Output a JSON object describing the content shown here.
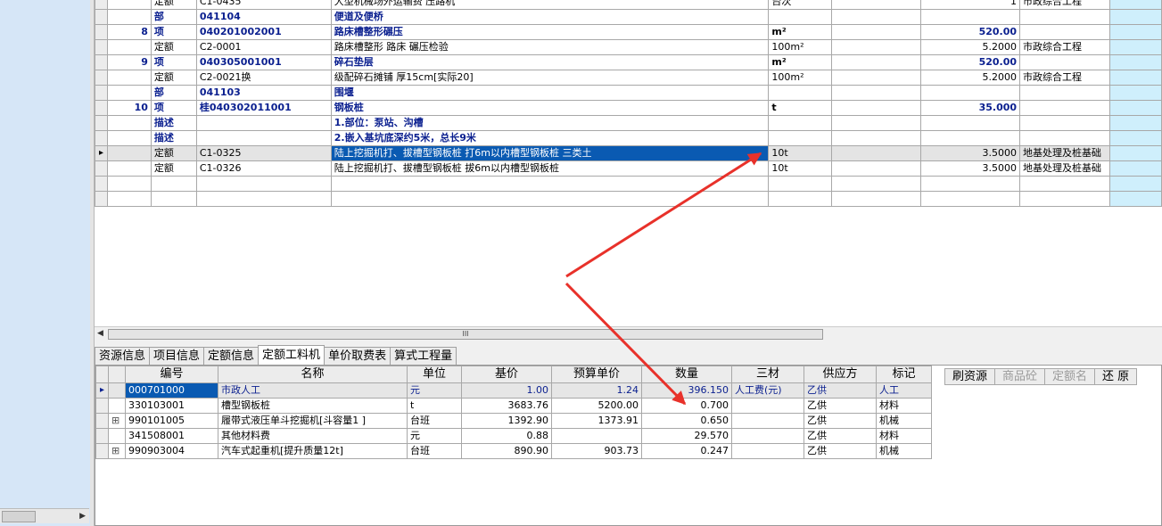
{
  "top_grid": {
    "rows": [
      {
        "type": "定额",
        "code": "C1-0435",
        "name": "大型机械场外运输费 压路机",
        "unit": "台次",
        "qty": "1",
        "cat": "市政综合工程",
        "style": "normal"
      },
      {
        "type": "部",
        "code": "041104",
        "name": "便道及便桥",
        "unit": "",
        "qty": "",
        "cat": "",
        "style": "bold"
      },
      {
        "no": "8",
        "type": "项",
        "code": "040201002001",
        "name": "路床槽整形碾压",
        "unit": "m²",
        "qty": "520.00",
        "cat": "",
        "style": "bold"
      },
      {
        "type": "定额",
        "code": "C2-0001",
        "name": "路床槽整形 路床 碾压检验",
        "unit": "100m²",
        "qty": "5.2000",
        "cat": "市政综合工程",
        "style": "normal"
      },
      {
        "no": "9",
        "type": "项",
        "code": "040305001001",
        "name": "碎石垫层",
        "unit": "m²",
        "qty": "520.00",
        "cat": "",
        "style": "bold"
      },
      {
        "type": "定额",
        "code": "C2-0021换",
        "name": "级配碎石摊铺 厚15cm[实际20]",
        "unit": "100m²",
        "qty": "5.2000",
        "cat": "市政综合工程",
        "style": "normal"
      },
      {
        "type": "部",
        "code": "041103",
        "name": "围堰",
        "unit": "",
        "qty": "",
        "cat": "",
        "style": "bold"
      },
      {
        "no": "10",
        "type": "项",
        "code": "桂040302011001",
        "name": "钢板桩",
        "unit": "t",
        "qty": "35.000",
        "cat": "",
        "style": "bold"
      },
      {
        "type": "描述",
        "code": "",
        "name": "1.部位：泵站、沟槽",
        "unit": "",
        "qty": "",
        "cat": "",
        "style": "bold"
      },
      {
        "type": "描述",
        "code": "",
        "name": "2.嵌入基坑底深约5米，总长9米",
        "unit": "",
        "qty": "",
        "cat": "",
        "style": "bold"
      },
      {
        "type": "定额",
        "code": "C1-0325",
        "name": "陆上挖掘机打、拔槽型钢板桩 打6m以内槽型钢板桩 三类土",
        "unit": "10t",
        "qty": "3.5000",
        "cat": "地基处理及桩基础",
        "style": "selected"
      },
      {
        "type": "定额",
        "code": "C1-0326",
        "name": "陆上挖掘机打、拔槽型钢板桩 拔6m以内槽型钢板桩",
        "unit": "10t",
        "qty": "3.5000",
        "cat": "地基处理及桩基础",
        "style": "normal"
      }
    ]
  },
  "hscroll": {
    "grip": "III"
  },
  "tabs": [
    "资源信息",
    "项目信息",
    "定额信息",
    "定额工料机",
    "单价取费表",
    "算式工程量"
  ],
  "active_tab": 3,
  "bottom_grid": {
    "headers": [
      "编号",
      "名称",
      "单位",
      "基价",
      "预算单价",
      "数量",
      "三材",
      "供应方",
      "标记"
    ],
    "rows": [
      {
        "tree": "",
        "code": "000701000",
        "name": "市政人工",
        "unit": "元",
        "base": "1.00",
        "budget": "1.24",
        "qty": "396.150",
        "mat": "人工费(元)",
        "supplier": "乙供",
        "mark": "人工"
      },
      {
        "tree": "",
        "code": "330103001",
        "name": "槽型钢板桩",
        "unit": "t",
        "base": "3683.76",
        "budget": "5200.00",
        "qty": "0.700",
        "mat": "",
        "supplier": "乙供",
        "mark": "材料"
      },
      {
        "tree": "⊞",
        "code": "990101005",
        "name": "履带式液压单斗挖掘机[斗容量1  ]",
        "unit": "台班",
        "base": "1392.90",
        "budget": "1373.91",
        "qty": "0.650",
        "mat": "",
        "supplier": "乙供",
        "mark": "机械"
      },
      {
        "tree": "",
        "code": "341508001",
        "name": "其他材料费",
        "unit": "元",
        "base": "0.88",
        "budget": "",
        "qty": "29.570",
        "mat": "",
        "supplier": "乙供",
        "mark": "材料"
      },
      {
        "tree": "⊞",
        "code": "990903004",
        "name": "汽车式起重机[提升质量12t]",
        "unit": "台班",
        "base": "890.90",
        "budget": "903.73",
        "qty": "0.247",
        "mat": "",
        "supplier": "乙供",
        "mark": "机械"
      }
    ]
  },
  "side_buttons": [
    {
      "label": "刷资源",
      "enabled": true
    },
    {
      "label": "商品砼",
      "enabled": false
    },
    {
      "label": "定额名",
      "enabled": false
    },
    {
      "label": "还 原",
      "enabled": true
    }
  ],
  "colors": {
    "selection": "#0a5ab2",
    "accent_text": "#0a1f8f",
    "arrow": "#e8312a"
  },
  "icons": {
    "row_pointer": "triangle-right",
    "expand": "plus-box"
  }
}
